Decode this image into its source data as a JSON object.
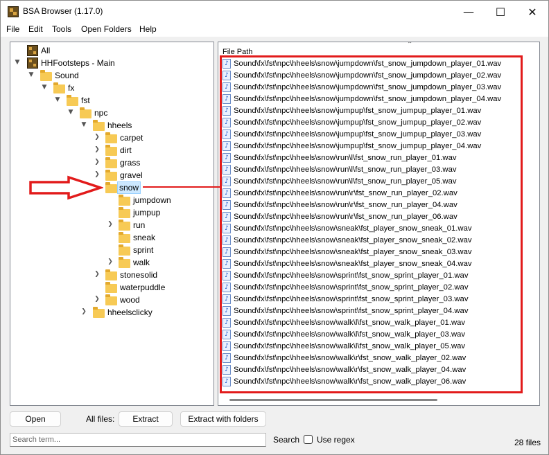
{
  "window": {
    "title": "BSA Browser (1.17.0)",
    "minimize_glyph": "—",
    "maximize_glyph": "☐",
    "close_glyph": "✕"
  },
  "menu": [
    "File",
    "Edit",
    "Tools",
    "Open Folders",
    "Help"
  ],
  "tree": {
    "all_label": "All",
    "archive_label": "HHFootsteps - Main",
    "folders": {
      "sound": "Sound",
      "fx": "fx",
      "fst": "fst",
      "npc": "npc",
      "hheels": "hheels",
      "carpet": "carpet",
      "dirt": "dirt",
      "grass": "grass",
      "gravel": "gravel",
      "snow": "snow",
      "jumpdown": "jumpdown",
      "jumpup": "jumpup",
      "run": "run",
      "sneak": "sneak",
      "sprint": "sprint",
      "walk": "walk",
      "stonesolid": "stonesolid",
      "waterpuddle": "waterpuddle",
      "wood": "wood",
      "hheelsclicky": "hheelsclicky"
    },
    "selected": "snow"
  },
  "file_list": {
    "column_header": "File Path",
    "files": [
      "Sound\\fx\\fst\\npc\\hheels\\snow\\jumpdown\\fst_snow_jumpdown_player_01.wav",
      "Sound\\fx\\fst\\npc\\hheels\\snow\\jumpdown\\fst_snow_jumpdown_player_02.wav",
      "Sound\\fx\\fst\\npc\\hheels\\snow\\jumpdown\\fst_snow_jumpdown_player_03.wav",
      "Sound\\fx\\fst\\npc\\hheels\\snow\\jumpdown\\fst_snow_jumpdown_player_04.wav",
      "Sound\\fx\\fst\\npc\\hheels\\snow\\jumpup\\fst_snow_jumpup_player_01.wav",
      "Sound\\fx\\fst\\npc\\hheels\\snow\\jumpup\\fst_snow_jumpup_player_02.wav",
      "Sound\\fx\\fst\\npc\\hheels\\snow\\jumpup\\fst_snow_jumpup_player_03.wav",
      "Sound\\fx\\fst\\npc\\hheels\\snow\\jumpup\\fst_snow_jumpup_player_04.wav",
      "Sound\\fx\\fst\\npc\\hheels\\snow\\run\\l\\fst_snow_run_player_01.wav",
      "Sound\\fx\\fst\\npc\\hheels\\snow\\run\\l\\fst_snow_run_player_03.wav",
      "Sound\\fx\\fst\\npc\\hheels\\snow\\run\\l\\fst_snow_run_player_05.wav",
      "Sound\\fx\\fst\\npc\\hheels\\snow\\run\\r\\fst_snow_run_player_02.wav",
      "Sound\\fx\\fst\\npc\\hheels\\snow\\run\\r\\fst_snow_run_player_04.wav",
      "Sound\\fx\\fst\\npc\\hheels\\snow\\run\\r\\fst_snow_run_player_06.wav",
      "Sound\\fx\\fst\\npc\\hheels\\snow\\sneak\\fst_player_snow_sneak_01.wav",
      "Sound\\fx\\fst\\npc\\hheels\\snow\\sneak\\fst_player_snow_sneak_02.wav",
      "Sound\\fx\\fst\\npc\\hheels\\snow\\sneak\\fst_player_snow_sneak_03.wav",
      "Sound\\fx\\fst\\npc\\hheels\\snow\\sneak\\fst_player_snow_sneak_04.wav",
      "Sound\\fx\\fst\\npc\\hheels\\snow\\sprint\\fst_snow_sprint_player_01.wav",
      "Sound\\fx\\fst\\npc\\hheels\\snow\\sprint\\fst_snow_sprint_player_02.wav",
      "Sound\\fx\\fst\\npc\\hheels\\snow\\sprint\\fst_snow_sprint_player_03.wav",
      "Sound\\fx\\fst\\npc\\hheels\\snow\\sprint\\fst_snow_sprint_player_04.wav",
      "Sound\\fx\\fst\\npc\\hheels\\snow\\walk\\l\\fst_snow_walk_player_01.wav",
      "Sound\\fx\\fst\\npc\\hheels\\snow\\walk\\l\\fst_snow_walk_player_03.wav",
      "Sound\\fx\\fst\\npc\\hheels\\snow\\walk\\l\\fst_snow_walk_player_05.wav",
      "Sound\\fx\\fst\\npc\\hheels\\snow\\walk\\r\\fst_snow_walk_player_02.wav",
      "Sound\\fx\\fst\\npc\\hheels\\snow\\walk\\r\\fst_snow_walk_player_04.wav",
      "Sound\\fx\\fst\\npc\\hheels\\snow\\walk\\r\\fst_snow_walk_player_06.wav"
    ]
  },
  "bottom": {
    "open_button": "Open",
    "all_files_label": "All files:",
    "extract_button": "Extract",
    "extract_folders_button": "Extract with folders",
    "search_placeholder": "Search term...",
    "search_label": "Search",
    "use_regex_label": "Use regex",
    "file_count": "28 files"
  },
  "colors": {
    "annotation_red": "#e21b1b",
    "selection_bg": "#cce8ff",
    "folder_yellow": "#f7ca55"
  }
}
